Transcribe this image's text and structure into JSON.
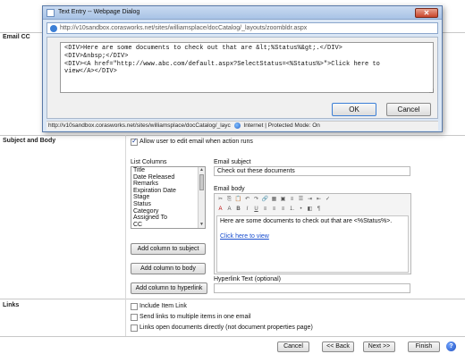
{
  "page": {
    "sections": {
      "email_cc": "Email CC",
      "subject_and_body": "Subject and Body",
      "links": "Links"
    },
    "allow_edit_label": "Allow user to edit email when action runs",
    "list_columns": {
      "header": "List Columns",
      "items": [
        "Title",
        "Date Released",
        "Remarks",
        "Expiration Date",
        "Stage",
        "Status",
        "Category",
        "Assigned To",
        "CC"
      ]
    },
    "email_subject": {
      "label": "Email subject",
      "value": "Check out these documents"
    },
    "email_body": {
      "label": "Email body",
      "text": "Here are some documents to check out that are <%Status%>.",
      "link_text": "Click here to view"
    },
    "buttons": {
      "add_subject": "Add column to subject",
      "add_body": "Add column to body",
      "add_hyperlink": "Add column to hyperlink"
    },
    "hyperlink_text_label": "Hyperlink Text (optional)",
    "link_options": [
      {
        "label": "Include Item Link",
        "checked": false
      },
      {
        "label": "Send links to multiple items in one email",
        "checked": false
      },
      {
        "label": "Links open documents directly (not document properties page)",
        "checked": false
      }
    ],
    "nav": {
      "cancel": "Cancel",
      "back": "<< Back",
      "next": "Next >>",
      "finish": "Finish"
    }
  },
  "dialog": {
    "title": "Text Entry -- Webpage Dialog",
    "address": "http://v10sandbox.corasworks.net/sites/williamsplace/docCatalog/_layouts/zoombldr.aspx",
    "code": "<DIV>Here are some documents to check out that are &lt;%Status%&gt;.</DIV>\n<DIV>&nbsp;</DIV>\n<DIV><A href=\"http://www.abc.com/default.aspx?SelectStatus=<%Status%>\">Click here to\nview</A></DIV>",
    "ok": "OK",
    "cancel": "Cancel",
    "status_url": "http://v10sandbox.corasworks.net/sites/williamsplace/docCatalog/_layc",
    "status_zone": "Internet | Protected Mode: On",
    "close_glyph": "✕"
  },
  "colors": {
    "link": "#1a4fcf",
    "dialog_bg": "#dbe7f5",
    "accent": "#2a62c8"
  }
}
